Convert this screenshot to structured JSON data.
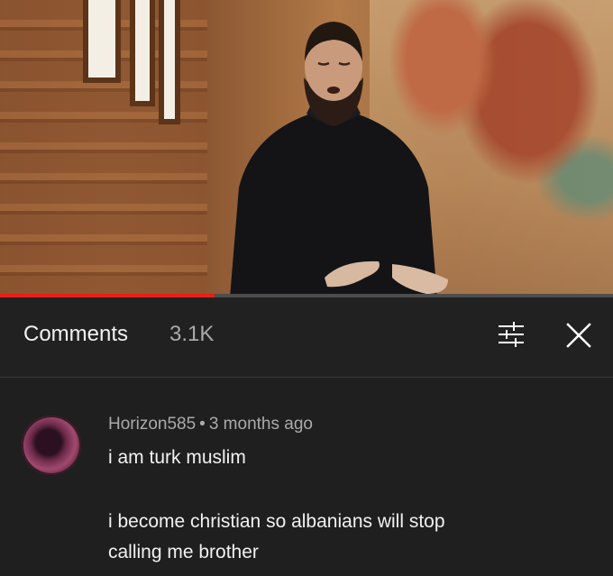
{
  "video": {
    "progress_fraction": 0.35,
    "progress_color": "#e62117",
    "scene": "priest-singing-in-church"
  },
  "comments_panel": {
    "title": "Comments",
    "count": "3.1K",
    "filter_icon": "sort-filter-icon",
    "close_icon": "close-icon"
  },
  "comment": {
    "author": "Horizon585",
    "separator": "•",
    "age": "3 months ago",
    "text_line1": "i am turk muslim",
    "text_line2": "i become christian so albanians will stop",
    "text_line3": "calling me brother"
  }
}
